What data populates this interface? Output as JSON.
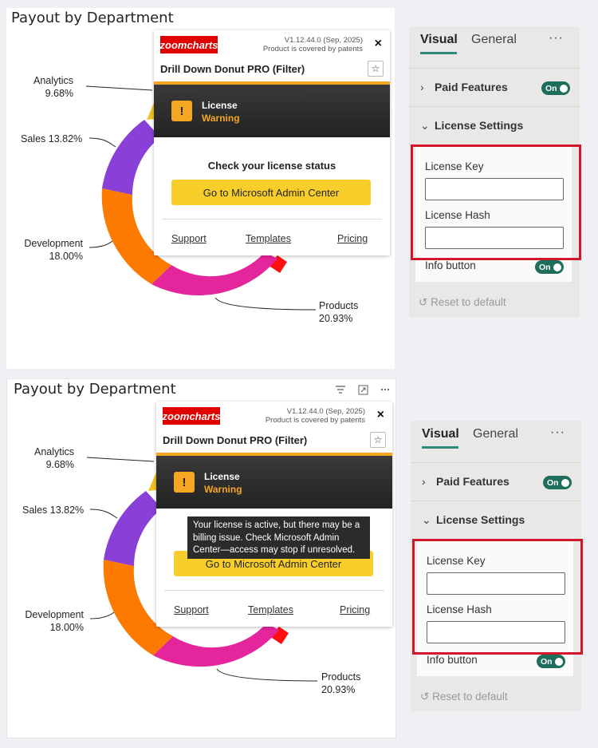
{
  "colors": {
    "analytics": "#f2c31f",
    "sales": "#8a3fd6",
    "development": "#fc7a00",
    "products": "#e5259b",
    "red": "#ff1010",
    "accent": "#1e6e5c",
    "highlight": "#d4162b",
    "zc_red": "#e00000",
    "warning": "#f5a623",
    "button": "#f8cf2a"
  },
  "chart_data": {
    "type": "pie",
    "title": "Payout by Department",
    "slices": [
      {
        "label": "Analytics",
        "value": 9.68,
        "display": "9.68%"
      },
      {
        "label": "Sales",
        "value": 13.82,
        "display": "13.82%"
      },
      {
        "label": "Development",
        "value": 18.0,
        "display": "18.00%"
      },
      {
        "label": "Products",
        "value": 20.93,
        "display": "20.93%"
      }
    ]
  },
  "top": {
    "labels": {
      "analytics_name": "Analytics",
      "analytics_pct": "9.68%",
      "sales": "Sales 13.82%",
      "dev_name": "Development",
      "dev_pct": "18.00%",
      "prod_name": "Products",
      "prod_pct": "20.93%"
    }
  },
  "popup": {
    "logo": "zoomcharts",
    "version": "V1.12.44.0 (Sep, 2025)",
    "patent": "Product is covered by patents",
    "close": "×",
    "title": "Drill Down Donut PRO (Filter)",
    "star": "☆",
    "warn_icon": "!",
    "license": "License",
    "warning": "Warning",
    "check": "Check your license status",
    "button": "Go to Microsoft Admin Center",
    "links": [
      "Support",
      "Templates",
      "Pricing"
    ],
    "tooltip": "Your license is active, but there may be a billing issue. Check Microsoft Admin Center—access may stop if unresolved."
  },
  "format_pane": {
    "tab_visual": "Visual",
    "tab_general": "General",
    "more": "···",
    "paid_features": "Paid Features",
    "license_settings": "License Settings",
    "toggle_on": "On",
    "license_key": "License Key",
    "license_hash": "License Hash",
    "info_button": "Info button",
    "reset": "Reset to default",
    "chevron_right": "›",
    "chevron_down": "⌄",
    "reset_icon": "↺"
  }
}
